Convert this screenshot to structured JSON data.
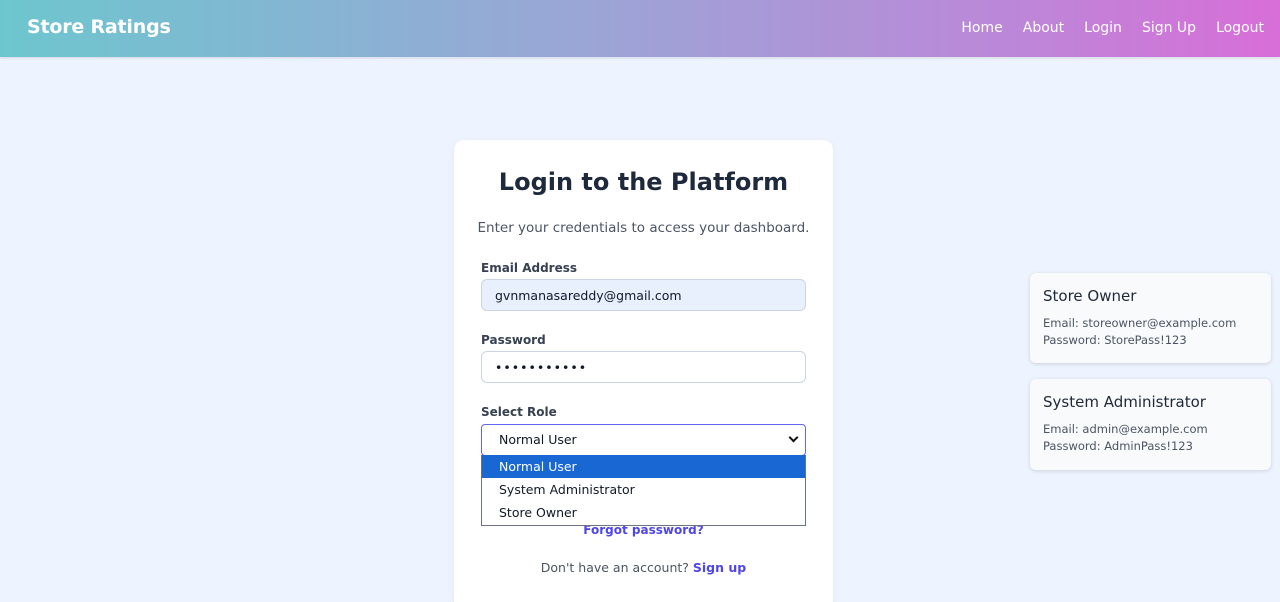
{
  "nav": {
    "brand": "Store Ratings",
    "links": [
      "Home",
      "About",
      "Login",
      "Sign Up",
      "Logout"
    ]
  },
  "login": {
    "title": "Login to the Platform",
    "subtitle": "Enter your credentials to access your dashboard.",
    "email_label": "Email Address",
    "email_value": "gvnmanasareddy@gmail.com",
    "password_label": "Password",
    "password_value": "•••••••••••",
    "role_label": "Select Role",
    "role_selected": "Normal User",
    "role_options": [
      "Normal User",
      "System Administrator",
      "Store Owner"
    ],
    "forgot": "Forgot password?",
    "signup_prompt": "Don't have an account?",
    "signup_link": "Sign up"
  },
  "info_cards": [
    {
      "title": "Store Owner",
      "email": "Email: storeowner@example.com",
      "password": "Password: StorePass!123"
    },
    {
      "title": "System Administrator",
      "email": "Email: admin@example.com",
      "password": "Password: AdminPass!123"
    }
  ],
  "colors": {
    "accent": "#4f46e5",
    "selected_option": "#1967d2",
    "page_bg": "#eef4ff"
  }
}
